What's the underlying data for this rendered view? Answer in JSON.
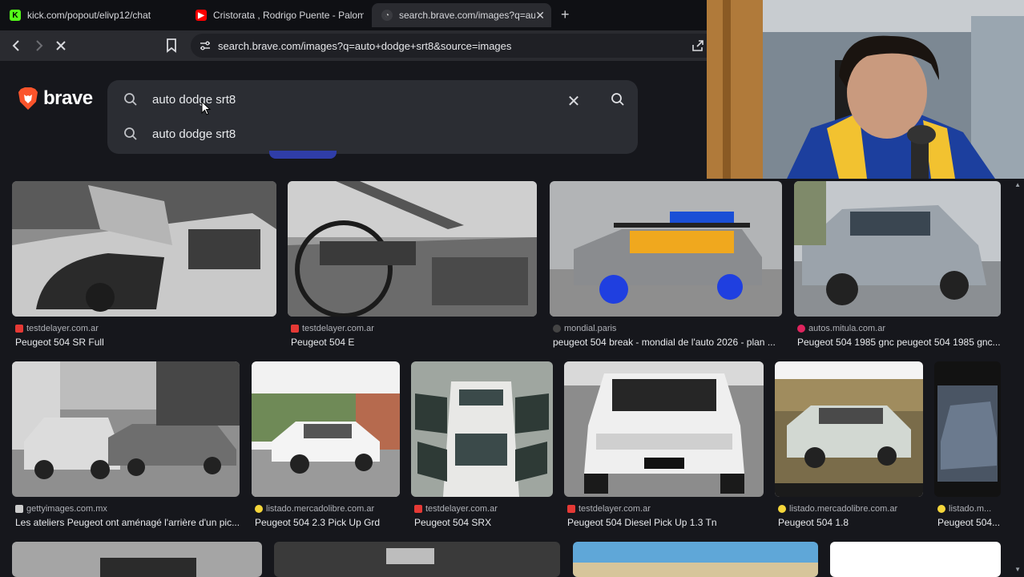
{
  "tabs": [
    {
      "label": "kick.com/popout/elivp12/chat",
      "favicon": "kick-icon"
    },
    {
      "label": "Cristorata , Rodrigo Puente - Palomit",
      "favicon": "youtube-icon"
    },
    {
      "label": "search.brave.com/images?q=auto",
      "favicon": "brave-search-icon",
      "active": true
    }
  ],
  "toolbar": {
    "url": "search.brave.com/images?q=auto+dodge+srt8&source=images"
  },
  "brand": {
    "name": "brave",
    "accent": "#fb542b"
  },
  "search": {
    "query": "auto dodge srt8",
    "suggestion": "auto dodge srt8"
  },
  "results": [
    {
      "source": "testdelayer.com.ar",
      "title": "Peugeot 504 SR Full",
      "icon_color": "#e53935"
    },
    {
      "source": "testdelayer.com.ar",
      "title": "Peugeot 504 E",
      "icon_color": "#e53935"
    },
    {
      "source": "mondial.paris",
      "title": "peugeot 504 break - mondial de l'auto 2026 - plan ...",
      "icon_color": "#444444"
    },
    {
      "source": "autos.mitula.com.ar",
      "title": "Peugeot 504 1985 gnc peugeot 504 1985 gnc...",
      "icon_color": "#e0245e"
    },
    {
      "source": "gettyimages.com.mx",
      "title": "Les ateliers Peugeot ont aménagé l'arrière d'un pic...",
      "icon_color": "#cccccc"
    },
    {
      "source": "listado.mercadolibre.com.ar",
      "title": "Peugeot 504 2.3 Pick Up Grd",
      "icon_color": "#f5d63a"
    },
    {
      "source": "testdelayer.com.ar",
      "title": "Peugeot 504 SRX",
      "icon_color": "#e53935"
    },
    {
      "source": "testdelayer.com.ar",
      "title": "Peugeot 504 Diesel Pick Up 1.3 Tn",
      "icon_color": "#e53935"
    },
    {
      "source": "listado.mercadolibre.com.ar",
      "title": "Peugeot 504 1.8",
      "icon_color": "#f5d63a"
    },
    {
      "source": "listado.m...",
      "title": "Peugeot 504...",
      "icon_color": "#f5d63a"
    }
  ]
}
